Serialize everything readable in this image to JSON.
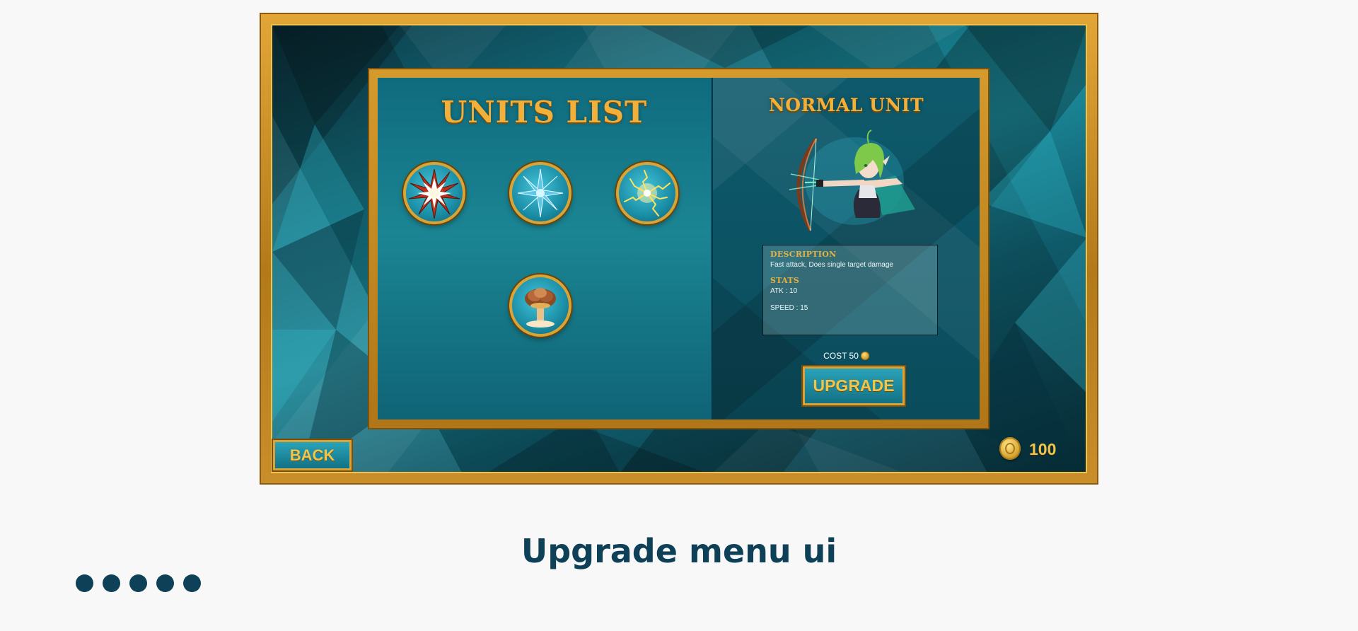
{
  "game": {
    "units_title": "UNITS LIST",
    "selected_unit": {
      "name": "NORMAL UNIT",
      "description_header": "DESCRIPTION",
      "description": "Fast attack, Does single target damage",
      "stats_header": "STATS",
      "atk": "ATK : 10",
      "speed": "SPEED : 15",
      "cost_label": "COST 50"
    },
    "units": [
      {
        "icon": "explosion-burst-icon"
      },
      {
        "icon": "ice-crystal-icon"
      },
      {
        "icon": "lightning-spark-icon"
      },
      {
        "icon": "mushroom-cloud-icon"
      }
    ],
    "upgrade_label": "UPGRADE",
    "back_label": "BACK",
    "coins": "100"
  },
  "caption": "Upgrade menu ui",
  "pagination": {
    "count": 5
  },
  "colors": {
    "gold": "#d9a437",
    "teal": "#137185",
    "title_gold": "#f2b03a",
    "caption": "#0e4157"
  }
}
